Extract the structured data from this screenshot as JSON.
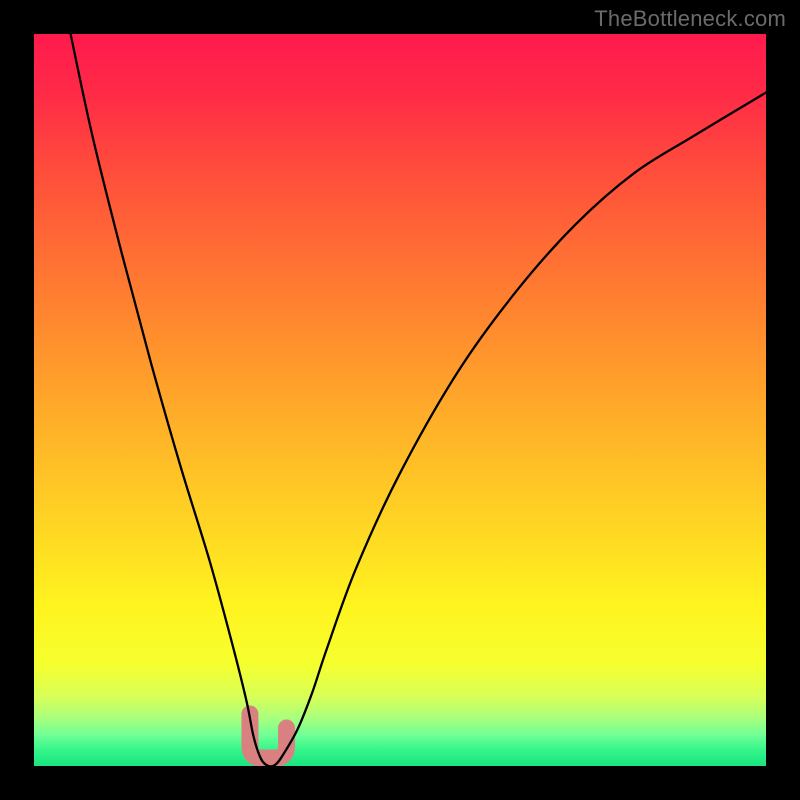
{
  "watermark": {
    "text": "TheBottleneck.com"
  },
  "gradient": {
    "stops": [
      {
        "offset": 0.0,
        "color": "#ff1a4d"
      },
      {
        "offset": 0.08,
        "color": "#ff2a47"
      },
      {
        "offset": 0.18,
        "color": "#ff4b3c"
      },
      {
        "offset": 0.3,
        "color": "#ff6e34"
      },
      {
        "offset": 0.42,
        "color": "#ff902d"
      },
      {
        "offset": 0.55,
        "color": "#ffb528"
      },
      {
        "offset": 0.68,
        "color": "#ffd823"
      },
      {
        "offset": 0.78,
        "color": "#fff31f"
      },
      {
        "offset": 0.86,
        "color": "#f6ff2e"
      },
      {
        "offset": 0.905,
        "color": "#d8ff57"
      },
      {
        "offset": 0.935,
        "color": "#a8ff7d"
      },
      {
        "offset": 0.958,
        "color": "#6fff96"
      },
      {
        "offset": 0.978,
        "color": "#35f58b"
      },
      {
        "offset": 1.0,
        "color": "#19e57e"
      }
    ]
  },
  "chart_data": {
    "type": "line",
    "title": "",
    "xlabel": "",
    "ylabel": "",
    "xlim": [
      0,
      100
    ],
    "ylim": [
      0,
      100
    ],
    "series": [
      {
        "name": "bottleneck-curve",
        "x": [
          5,
          8,
          12,
          16,
          20,
          24,
          27,
          29,
          30,
          31,
          32,
          33,
          34,
          36,
          38,
          40,
          44,
          50,
          58,
          66,
          74,
          82,
          90,
          100
        ],
        "y": [
          100,
          86,
          70,
          55,
          41,
          28,
          17,
          9,
          4,
          1,
          0,
          0.2,
          1.5,
          5,
          10,
          16,
          27,
          40,
          54,
          65,
          74,
          81,
          86,
          92
        ]
      }
    ],
    "min_marker": {
      "x_center": 31.5,
      "x_start": 29.5,
      "x_end": 34.5,
      "color": "#d98181"
    }
  }
}
